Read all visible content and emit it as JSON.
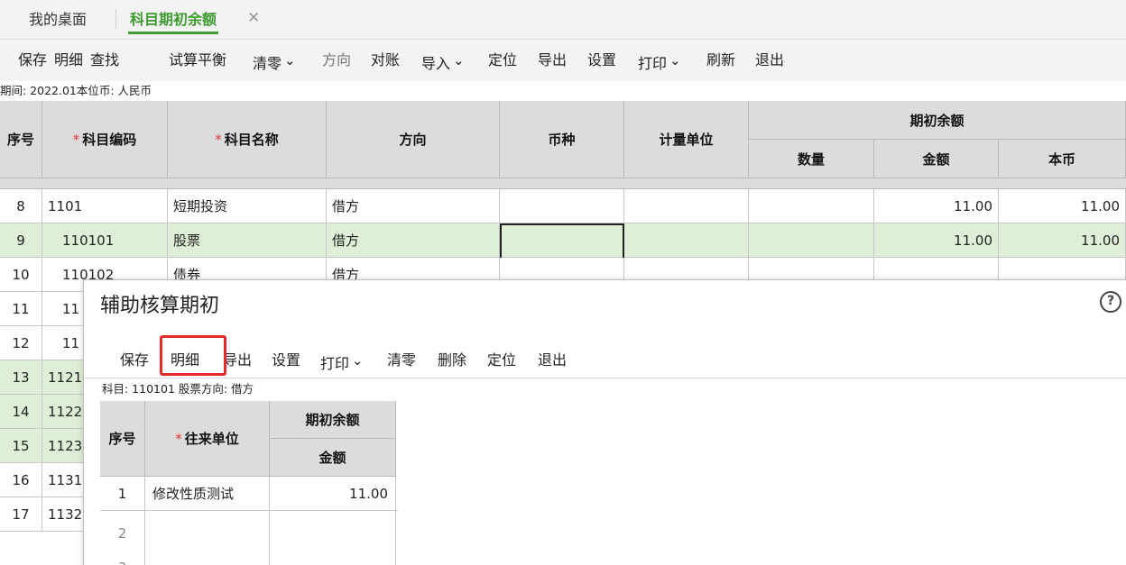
{
  "tabs": {
    "home": "我的桌面",
    "active": "科目期初余额",
    "close": "✕"
  },
  "toolbar": [
    {
      "label": "保存",
      "name": "save-button",
      "caret": false,
      "disabled": false
    },
    {
      "label": "明细",
      "name": "detail-button",
      "caret": false,
      "disabled": false
    },
    {
      "label": "查找",
      "name": "find-button",
      "caret": false,
      "disabled": false
    },
    {
      "label": "试算平衡",
      "name": "trial-balance-button",
      "caret": false,
      "disabled": false
    },
    {
      "label": "清零",
      "name": "clear-button",
      "caret": true,
      "disabled": false
    },
    {
      "label": "方向",
      "name": "direction-button",
      "caret": false,
      "disabled": true
    },
    {
      "label": "对账",
      "name": "reconcile-button",
      "caret": false,
      "disabled": false
    },
    {
      "label": "导入",
      "name": "import-button",
      "caret": true,
      "disabled": false
    },
    {
      "label": "定位",
      "name": "locate-button",
      "caret": false,
      "disabled": false
    },
    {
      "label": "导出",
      "name": "export-button",
      "caret": false,
      "disabled": false
    },
    {
      "label": "设置",
      "name": "settings-button",
      "caret": false,
      "disabled": false
    },
    {
      "label": "打印",
      "name": "print-button",
      "caret": true,
      "disabled": false
    },
    {
      "label": "刷新",
      "name": "refresh-button",
      "caret": false,
      "disabled": false
    },
    {
      "label": "退出",
      "name": "exit-button",
      "caret": false,
      "disabled": false
    }
  ],
  "info": {
    "text": "期间: 2022.01本位币: 人民币"
  },
  "grid": {
    "headers": {
      "seq": "序号",
      "code": "科目编码",
      "name": "科目名称",
      "direction": "方向",
      "currency": "币种",
      "unit": "计量单位",
      "opening": "期初余额",
      "qty": "数量",
      "amount": "金额",
      "base": "本币"
    },
    "rows": [
      {
        "seq": "8",
        "code": "1101",
        "name": "短期投资",
        "dir": "借方",
        "amount": "11.00",
        "base": "11.00",
        "style": "white",
        "indent": false
      },
      {
        "seq": "9",
        "code": "110101",
        "name": "股票",
        "dir": "借方",
        "amount": "11.00",
        "base": "11.00",
        "style": "green",
        "indent": true
      },
      {
        "seq": "10",
        "code": "110102",
        "name": "债券",
        "dir": "借方",
        "amount": "",
        "base": "",
        "style": "white",
        "indent": true
      },
      {
        "seq": "11",
        "code": "11",
        "name": "",
        "dir": "",
        "amount": "",
        "base": "",
        "style": "white",
        "indent": true
      },
      {
        "seq": "12",
        "code": "11",
        "name": "",
        "dir": "",
        "amount": "",
        "base": "",
        "style": "white",
        "indent": true
      },
      {
        "seq": "13",
        "code": "1121",
        "name": "",
        "dir": "",
        "amount": "",
        "base": "",
        "style": "green",
        "indent": false
      },
      {
        "seq": "14",
        "code": "1122",
        "name": "",
        "dir": "",
        "amount": "",
        "base": "",
        "style": "green",
        "indent": false
      },
      {
        "seq": "15",
        "code": "1123",
        "name": "",
        "dir": "",
        "amount": "",
        "base": "",
        "style": "green",
        "indent": false
      },
      {
        "seq": "16",
        "code": "1131",
        "name": "",
        "dir": "",
        "amount": "",
        "base": "",
        "style": "white",
        "indent": false
      },
      {
        "seq": "17",
        "code": "1132",
        "name": "",
        "dir": "",
        "amount": "",
        "base": "",
        "style": "white",
        "indent": false
      }
    ]
  },
  "dialog": {
    "title": "辅助核算期初",
    "help": "?",
    "toolbar": [
      {
        "label": "保存",
        "name": "dialog-save-button",
        "caret": false
      },
      {
        "label": "明细",
        "name": "dialog-detail-button",
        "caret": false
      },
      {
        "label": "导出",
        "name": "dialog-export-button",
        "caret": false
      },
      {
        "label": "设置",
        "name": "dialog-settings-button",
        "caret": false
      },
      {
        "label": "打印",
        "name": "dialog-print-button",
        "caret": true
      },
      {
        "label": "清零",
        "name": "dialog-clear-button",
        "caret": false
      },
      {
        "label": "删除",
        "name": "dialog-delete-button",
        "caret": false
      },
      {
        "label": "定位",
        "name": "dialog-locate-button",
        "caret": false
      },
      {
        "label": "退出",
        "name": "dialog-exit-button",
        "caret": false
      }
    ],
    "info": "科目: 110101 股票方向: 借方",
    "headers": {
      "seq": "序号",
      "partner": "往来单位",
      "opening": "期初余额",
      "amount": "金额"
    },
    "rows": [
      {
        "seq": "1",
        "partner": "修改性质测试",
        "amount": "11.00"
      },
      {
        "seq": "2",
        "partner": "",
        "amount": ""
      },
      {
        "seq": "3",
        "partner": "",
        "amount": ""
      }
    ]
  },
  "colors": {
    "accent": "#3c9a2e",
    "highlight": "#e52a2a",
    "row_green": "#dfeed6",
    "required": "#e03434"
  }
}
